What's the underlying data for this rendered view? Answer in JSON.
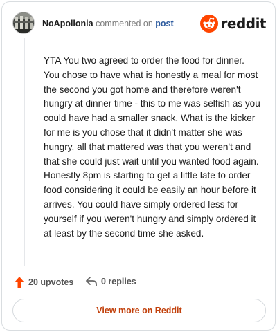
{
  "header": {
    "username": "NoApollonia",
    "action_text": "commented on",
    "post_link": "post",
    "brand_name": "reddit"
  },
  "comment": {
    "body": "YTA You two agreed to order the food for dinner. You chose to have what is honestly a meal for most the second you got home and therefore weren't hungry at dinner time - this to me was selfish as you could have had a smaller snack. What is the kicker for me is you chose that it didn't matter she was hungry, all that mattered was that you weren't and that she could just wait until you wanted food again. Honestly 8pm is starting to get a little late to order food considering it could be easily an hour before it arrives. You could have simply ordered less for yourself if you weren't hungry and simply ordered it at least by the second time she asked."
  },
  "footer": {
    "upvotes_label": "20 upvotes",
    "replies_label": "0 replies"
  },
  "view_more_label": "View more on Reddit",
  "icons": {
    "avatar": "avatar-image",
    "brand": "reddit-logo-icon",
    "upvote": "upvote-arrow-icon",
    "reply": "reply-arrow-icon"
  },
  "colors": {
    "brand_orange": "#ff4500",
    "upvote_arrow": "#ff4500",
    "post_link": "#2c5a9e",
    "view_more": "#c2410c"
  }
}
